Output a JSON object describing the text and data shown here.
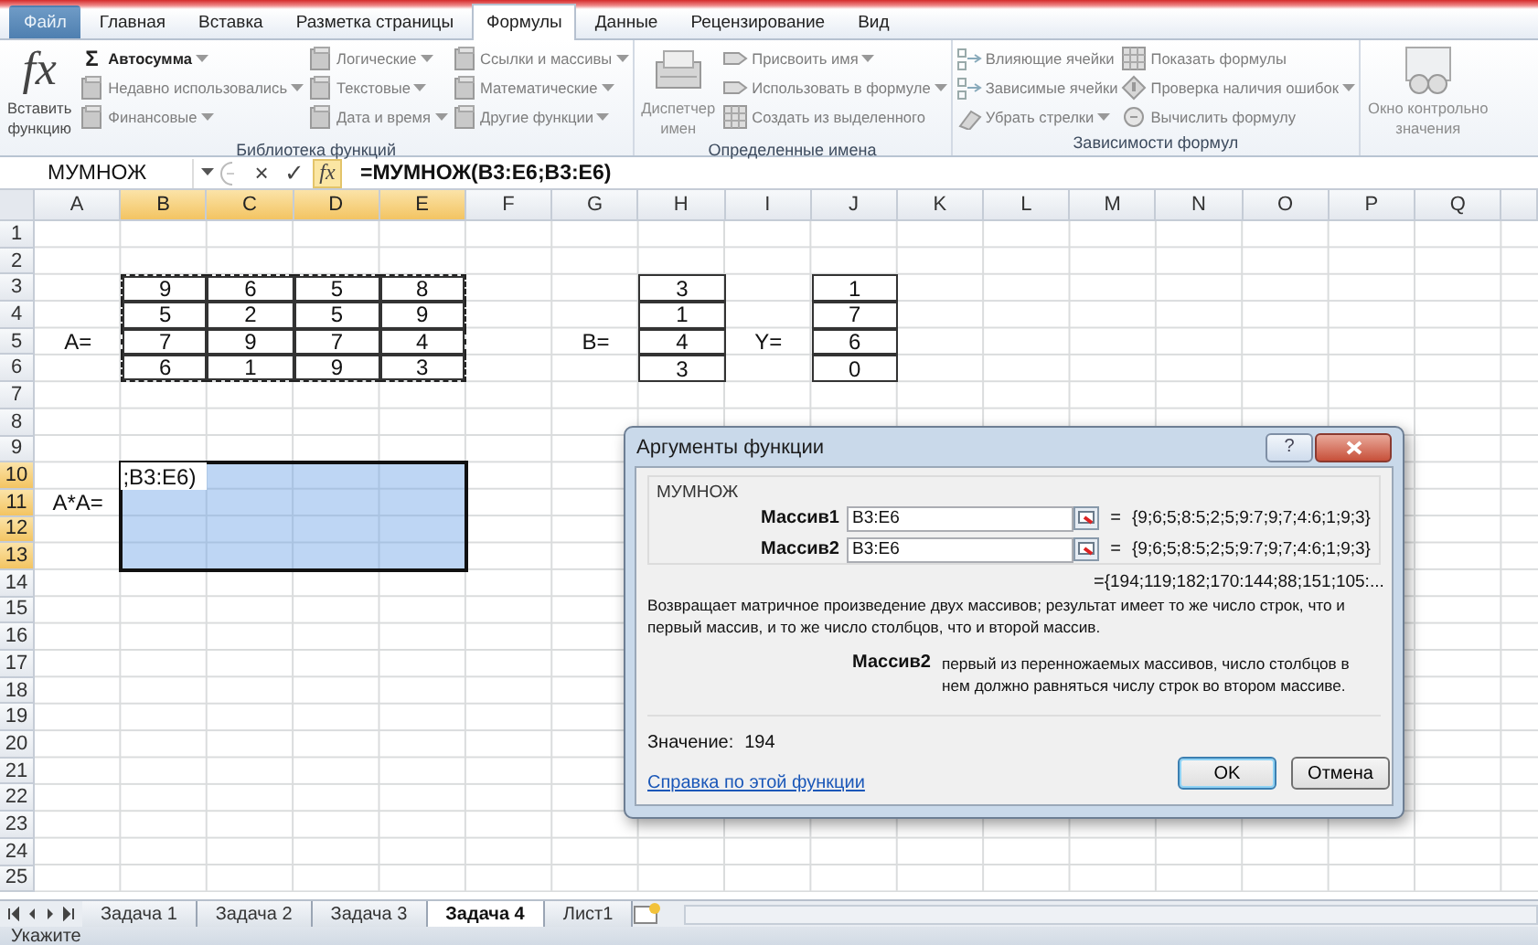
{
  "ribbon_tabs": [
    {
      "label": "Файл",
      "selected": false,
      "kind": "file"
    },
    {
      "label": "Главная",
      "selected": false,
      "kind": "tab"
    },
    {
      "label": "Вставка",
      "selected": false,
      "kind": "tab"
    },
    {
      "label": "Разметка страницы",
      "selected": false,
      "kind": "tab"
    },
    {
      "label": "Формулы",
      "selected": true,
      "kind": "tab"
    },
    {
      "label": "Данные",
      "selected": false,
      "kind": "tab"
    },
    {
      "label": "Рецензирование",
      "selected": false,
      "kind": "tab"
    },
    {
      "label": "Вид",
      "selected": false,
      "kind": "tab"
    }
  ],
  "ribbon_groups": [
    {
      "title": "Библиотека функций",
      "controls": [
        {
          "kind": "large",
          "symbol": "fx",
          "lines": [
            "Вставить",
            "функцию"
          ],
          "disabled": false
        },
        {
          "kind": "column",
          "items": [
            {
              "label": "Автосумма",
              "symbol": "Σ",
              "dropdown": true,
              "disabled": false
            },
            {
              "label": "Недавно использовались",
              "dropdown": true,
              "disabled": true
            },
            {
              "label": "Финансовые",
              "dropdown": true,
              "disabled": true
            }
          ]
        },
        {
          "kind": "column",
          "items": [
            {
              "label": "Логические",
              "dropdown": true,
              "disabled": true
            },
            {
              "label": "Текстовые",
              "dropdown": true,
              "disabled": true
            },
            {
              "label": "Дата и время",
              "dropdown": true,
              "disabled": true
            }
          ]
        },
        {
          "kind": "column",
          "items": [
            {
              "label": "Ссылки и массивы",
              "dropdown": true,
              "disabled": true
            },
            {
              "label": "Математические",
              "dropdown": true,
              "disabled": true
            },
            {
              "label": "Другие функции",
              "dropdown": true,
              "disabled": true
            }
          ]
        }
      ]
    },
    {
      "title": "Определенные имена",
      "controls": [
        {
          "kind": "large",
          "lines": [
            "Диспетчер",
            "имен"
          ],
          "disabled": true
        },
        {
          "kind": "column",
          "items": [
            {
              "label": "Присвоить имя",
              "dropdown": true,
              "disabled": true
            },
            {
              "label": "Использовать в формуле",
              "dropdown": true,
              "disabled": true
            },
            {
              "label": "Создать из выделенного",
              "dropdown": false,
              "disabled": true
            }
          ]
        }
      ]
    },
    {
      "title": "Зависимости формул",
      "controls": [
        {
          "kind": "column",
          "items": [
            {
              "label": "Влияющие ячейки",
              "dropdown": false,
              "disabled": true
            },
            {
              "label": "Зависимые ячейки",
              "dropdown": false,
              "disabled": true
            },
            {
              "label": "Убрать стрелки",
              "dropdown": true,
              "disabled": true
            }
          ]
        },
        {
          "kind": "column",
          "items": [
            {
              "label": "Показать формулы",
              "dropdown": false,
              "disabled": true
            },
            {
              "label": "Проверка наличия ошибок",
              "dropdown": true,
              "disabled": true
            },
            {
              "label": "Вычислить формулу",
              "dropdown": false,
              "disabled": true
            }
          ]
        }
      ]
    },
    {
      "controls": [
        {
          "kind": "large",
          "lines": [
            "Окно контрольно",
            "значения"
          ],
          "disabled": true
        }
      ]
    }
  ],
  "formula_bar": {
    "name_box": "МУМНОЖ",
    "buttons": [
      {
        "label": "×",
        "kind": "cancel"
      },
      {
        "label": "✓",
        "kind": "enter"
      },
      {
        "label": "fx",
        "kind": "function"
      }
    ],
    "formula": "=МУМНОЖ(B3:E6;B3:E6)"
  },
  "sheet": {
    "columns": [
      {
        "label": "A",
        "selected": false
      },
      {
        "label": "B",
        "selected": true
      },
      {
        "label": "C",
        "selected": true
      },
      {
        "label": "D",
        "selected": true
      },
      {
        "label": "E",
        "selected": true
      },
      {
        "label": "F",
        "selected": false
      },
      {
        "label": "G",
        "selected": false
      },
      {
        "label": "H",
        "selected": false
      },
      {
        "label": "I",
        "selected": false
      },
      {
        "label": "J",
        "selected": false
      },
      {
        "label": "K",
        "selected": false
      },
      {
        "label": "L",
        "selected": false
      },
      {
        "label": "M",
        "selected": false
      },
      {
        "label": "N",
        "selected": false
      },
      {
        "label": "O",
        "selected": false
      },
      {
        "label": "P",
        "selected": false
      },
      {
        "label": "Q",
        "selected": false
      }
    ],
    "rows": [
      {
        "label": "1",
        "selected": false
      },
      {
        "label": "2",
        "selected": false
      },
      {
        "label": "3",
        "selected": false,
        "cells": [
          {},
          {
            "text": "9",
            "boxed": true,
            "copied": true
          },
          {
            "text": "6",
            "boxed": true,
            "copied": true
          },
          {
            "text": "5",
            "boxed": true,
            "copied": true
          },
          {
            "text": "8",
            "boxed": true,
            "copied": true
          },
          {},
          {},
          {
            "text": "3",
            "boxed": true
          },
          {},
          {
            "text": "1",
            "boxed": true
          }
        ]
      },
      {
        "label": "4",
        "selected": false,
        "cells": [
          {},
          {
            "text": "5",
            "boxed": true,
            "copied": true
          },
          {
            "text": "2",
            "boxed": true,
            "copied": true
          },
          {
            "text": "5",
            "boxed": true,
            "copied": true
          },
          {
            "text": "9",
            "boxed": true,
            "copied": true
          },
          {},
          {},
          {
            "text": "1",
            "boxed": true
          },
          {},
          {
            "text": "7",
            "boxed": true
          }
        ]
      },
      {
        "label": "5",
        "selected": false,
        "cells": [
          {
            "text": "A=",
            "boxed": false
          },
          {
            "text": "7",
            "boxed": true,
            "copied": true
          },
          {
            "text": "9",
            "boxed": true,
            "copied": true
          },
          {
            "text": "7",
            "boxed": true,
            "copied": true
          },
          {
            "text": "4",
            "boxed": true,
            "copied": true
          },
          {},
          {
            "text": "B=",
            "boxed": false
          },
          {
            "text": "4",
            "boxed": true
          },
          {
            "text": "Y=",
            "boxed": false
          },
          {
            "text": "6",
            "boxed": true
          }
        ]
      },
      {
        "label": "6",
        "selected": false,
        "cells": [
          {},
          {
            "text": "6",
            "boxed": true,
            "copied": true
          },
          {
            "text": "1",
            "boxed": true,
            "copied": true
          },
          {
            "text": "9",
            "boxed": true,
            "copied": true
          },
          {
            "text": "3",
            "boxed": true,
            "copied": true
          },
          {},
          {},
          {
            "text": "3",
            "boxed": true
          },
          {},
          {
            "text": "0",
            "boxed": true
          }
        ]
      },
      {
        "label": "7",
        "selected": false
      },
      {
        "label": "8",
        "selected": false
      },
      {
        "label": "9",
        "selected": false
      },
      {
        "label": "10",
        "selected": true,
        "cells": [
          {},
          {
            "text": ";B3:E6)",
            "kind": "editing"
          }
        ]
      },
      {
        "label": "11",
        "selected": true,
        "cells": [
          {
            "text": "A*A=",
            "boxed": false
          }
        ]
      },
      {
        "label": "12",
        "selected": true
      },
      {
        "label": "13",
        "selected": true
      },
      {
        "label": "14",
        "selected": false
      },
      {
        "label": "15",
        "selected": false
      },
      {
        "label": "16",
        "selected": false
      },
      {
        "label": "17",
        "selected": false
      },
      {
        "label": "18",
        "selected": false
      },
      {
        "label": "19",
        "selected": false
      },
      {
        "label": "20",
        "selected": false
      },
      {
        "label": "21",
        "selected": false
      },
      {
        "label": "22",
        "selected": false
      },
      {
        "label": "23",
        "selected": false
      },
      {
        "label": "24",
        "selected": false
      },
      {
        "label": "25",
        "selected": false
      }
    ]
  },
  "dialog": {
    "title": "Аргументы функции",
    "help": "?",
    "function": "МУМНОЖ",
    "arguments": [
      {
        "label": "Массив1",
        "value": "B3:E6",
        "sign": "=",
        "result": "{9;6;5;8:5;2;5;9:7;9;7;4:6;1;9;3}"
      },
      {
        "label": "Массив2",
        "value": "B3:E6",
        "sign": "=",
        "result": "{9;6;5;8:5;2;5;9:7;9;7;4:6;1;9;3}"
      }
    ],
    "result": {
      "sign": "=",
      "text": "{194;119;182;170:144;88;151;105:..."
    },
    "description": "Возвращает матричное произведение двух массивов; результат имеет то же число строк, что и первый массив, и то же число столбцов, что и второй массив.",
    "argument_help": {
      "label": "Массив2",
      "text": "первый из перенножаемых массивов, число столбцов в нем должно равняться числу строк во втором массиве."
    },
    "value": {
      "label": "Значение:",
      "text": "194"
    },
    "help_link": "Справка по этой функции",
    "buttons": [
      {
        "label": "OK",
        "default": true
      },
      {
        "label": "Отмена",
        "default": false
      }
    ]
  },
  "sheet_tabs": [
    {
      "label": "Задача 1",
      "selected": false
    },
    {
      "label": "Задача 2",
      "selected": false
    },
    {
      "label": "Задача 3",
      "selected": false
    },
    {
      "label": "Задача 4",
      "selected": true
    },
    {
      "label": "Лист1",
      "selected": false
    }
  ],
  "status": "Укажите"
}
